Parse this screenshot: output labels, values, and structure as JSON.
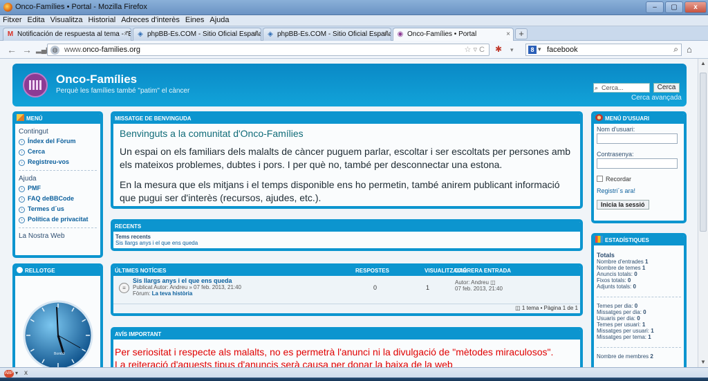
{
  "window": {
    "title": "Onco-Famílies • Portal - Mozilla Firefox",
    "min": "–",
    "max": "▢",
    "close": "x"
  },
  "menubar": [
    "Fitxer",
    "Edita",
    "Visualitza",
    "Historial",
    "Adreces d'interès",
    "Eines",
    "Ajuda"
  ],
  "tabs": [
    {
      "label": "Notificación de respuesta al tema - \"E...",
      "icon": "gmail-icon",
      "active": false
    },
    {
      "label": "phpBB-Es.COM - Sitio Oficial España ...",
      "icon": "phpbb-icon",
      "active": false
    },
    {
      "label": "phpBB-Es.COM - Sitio Oficial España ...",
      "icon": "phpbb-icon",
      "active": false
    },
    {
      "label": "Onco-Famílies • Portal",
      "icon": "site-icon",
      "active": true
    }
  ],
  "newtab": "+",
  "navbar": {
    "url_prefix": "www.",
    "url_domain": "onco-families.org",
    "search_text": "facebook"
  },
  "header": {
    "title": "Onco-Famílies",
    "description": "Perquè les famílies també \"patim\" el càncer",
    "search_placeholder": "Cerca...",
    "search_button": "Cerca",
    "advanced": "Cerca avançada"
  },
  "menu": {
    "title": "MENÚ",
    "content_heading": "Contingut",
    "content_items": [
      "Índex del Fòrum",
      "Cerca",
      "Registreu-vos"
    ],
    "help_heading": "Ajuda",
    "help_items": [
      "PMF",
      "FAQ deBBCode",
      "Termes d´us",
      "Política de privacitat"
    ],
    "web_link": "La Nostra Web"
  },
  "clock": {
    "title": "RELLOTGE",
    "brand": "Bomb3"
  },
  "welcome": {
    "title": "MISSATGE DE BENVINGUDA",
    "heading": "Benvinguts a la comunitat d'Onco-Famílies",
    "para1": "Un espai on els familiars dels malalts de càncer puguem parlar, escoltar i ser escoltats per persones amb els mateixos problemes, dubtes i pors. I per què no, també per desconnectar una estona.",
    "para2": "En la mesura que els mitjans i el temps disponible ens ho permetin, també anirem publicant informació que pugui ser d'interès (recursos, ajudes, etc.)."
  },
  "recent": {
    "title": "RECENTS",
    "label": "Tems recents",
    "link": "Sis llargs anys i el que ens queda"
  },
  "news": {
    "title": "ÚLTIMES NOTÍCIES",
    "col_replies": "RESPOSTES",
    "col_views": "VISUALITZACIÓ",
    "col_last": "DARRERA ENTRADA",
    "rows": [
      {
        "topic": "Sis llargs anys i el que ens queda",
        "meta": "Publicat Autor: Andreu » 07 feb. 2013, 21:40",
        "forum_label": "Fòrum:",
        "forum": "La teva història",
        "replies": "0",
        "views": "1",
        "last_author": "Autor: Andreu",
        "last_date": "07 feb. 2013, 21:40"
      }
    ],
    "pagination": "1 tema • Pàgina 1 de 1"
  },
  "notice": {
    "title": "AVÍS IMPORTANT",
    "text": "Per seriositat i respecte als malalts, no es permetrà l'anunci ni la divulgació de \"mètodes miraculosos\". La reiteració d'aquests tipus d'anuncis serà causa per donar la baixa de la web"
  },
  "usermenu": {
    "title": "MENÚ D'USUARI",
    "username_label": "Nom d'usuari:",
    "password_label": "Contrasenya:",
    "remember": "Recordar",
    "register": "Registri´s ara!",
    "login_button": "Inicia la sessió"
  },
  "stats": {
    "title": "ESTADÍSTIQUES",
    "totals_heading": "Totals",
    "totals": [
      {
        "label": "Nombre d'entrades",
        "value": "1"
      },
      {
        "label": "Nombre de temes",
        "value": "1"
      },
      {
        "label": "Anuncis totals:",
        "value": "0"
      },
      {
        "label": "Fixos totals:",
        "value": "0"
      },
      {
        "label": "Adjunts totals:",
        "value": "0"
      }
    ],
    "per_day": [
      {
        "label": "Temes per dia:",
        "value": "0"
      },
      {
        "label": "Missatges per dia:",
        "value": "0"
      },
      {
        "label": "Usuaris per dia:",
        "value": "0"
      },
      {
        "label": "Temes per usuari:",
        "value": "1"
      },
      {
        "label": "Missatges per usuari:",
        "value": "1"
      },
      {
        "label": "Missatges per tema:",
        "value": "1"
      }
    ],
    "members_label": "Nombre de membres",
    "members_value": "2"
  },
  "statusbar": {
    "close": "x"
  },
  "colors": {
    "accent": "#0c95cf",
    "title_teal": "#0f6b78",
    "notice_red": "#e00000"
  }
}
